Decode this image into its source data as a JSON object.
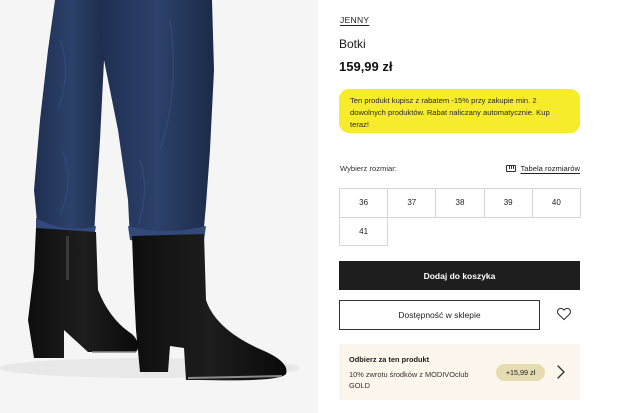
{
  "product": {
    "brand": "JENNY",
    "name": "Botki",
    "price": "159,99 zł",
    "image_icon": "product-photo-ankle-boots"
  },
  "promo": {
    "text": "Ten produkt kupisz z rabatem -15% przy zakupie min. 2 dowolnych produktów. Rabat naliczany automatycznie. Kup teraz!",
    "color": "#f6ec2c"
  },
  "sizes": {
    "label": "Wybierz rozmiar:",
    "table_link": "Tabela rozmiarów",
    "table_icon": "ruler-icon",
    "options": [
      "36",
      "37",
      "38",
      "39",
      "40",
      "41"
    ]
  },
  "actions": {
    "add_to_cart": "Dodaj do koszyka",
    "store_availability": "Dostępność w sklepie",
    "wishlist_icon": "heart-icon"
  },
  "club": {
    "title": "Odbierz za ten produkt",
    "text": "10% zwrotu środków z MODIVOclub GOLD",
    "badge": "+15,99 zł",
    "chevron_icon": "chevron-right-icon",
    "background": "#fcf6ec"
  }
}
